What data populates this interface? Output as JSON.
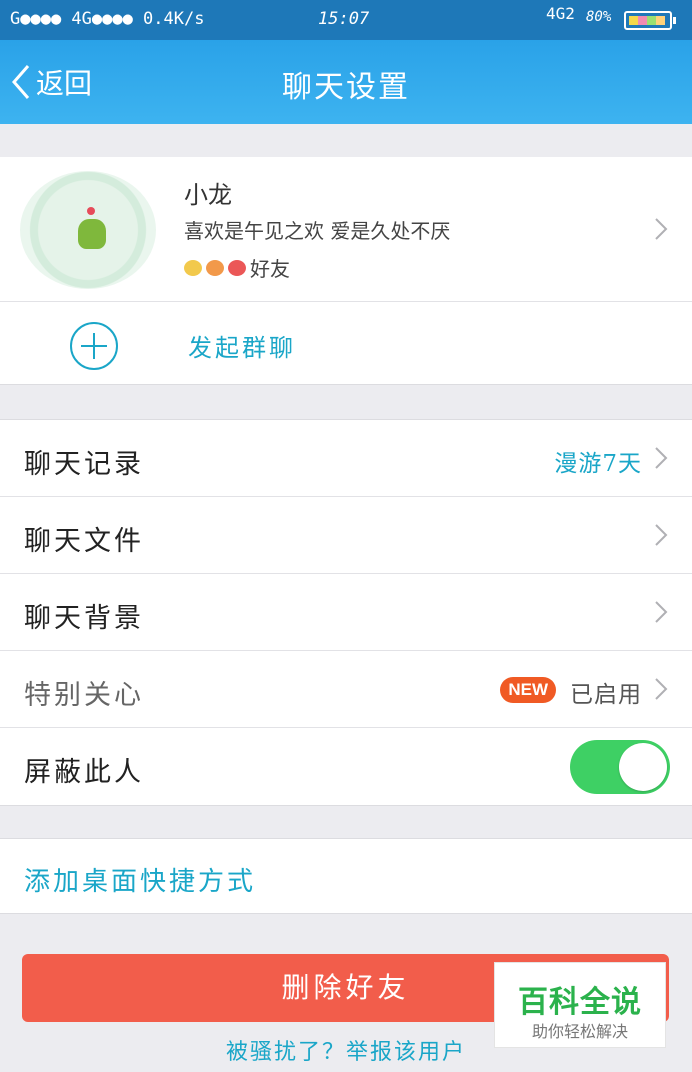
{
  "status_bar": {
    "left": "G●●●● 4G●●●● 0.4K/s",
    "time": "15:07",
    "network": "4G2",
    "battery": "80%"
  },
  "header": {
    "back_label": "返回",
    "title": "聊天设置"
  },
  "profile": {
    "name": "小龙",
    "signature": "喜欢是午见之欢 爱是久处不厌",
    "extra": "好友"
  },
  "group_chat": {
    "label": "发起群聊"
  },
  "settings": {
    "chat_history": {
      "label": "聊天记录",
      "value": "漫游7天"
    },
    "chat_files": {
      "label": "聊天文件"
    },
    "chat_background": {
      "label": "聊天背景"
    },
    "special_care": {
      "label": "特别关心",
      "badge": "NEW",
      "value": "已启用"
    },
    "block": {
      "label": "屏蔽此人",
      "enabled": true
    }
  },
  "shortcut": {
    "label": "添加桌面快捷方式"
  },
  "delete_button": {
    "label": "删除好友"
  },
  "report_link": {
    "label": "被骚扰了？举报该用户"
  },
  "watermark": {
    "title": "百科全说",
    "subtitle": "助你轻松解决"
  },
  "colors": {
    "accent": "#1aa6c8",
    "header": "#2aa2e8",
    "toggle_on": "#3ed064",
    "danger": "#f25d4b",
    "new_badge": "#f05a24"
  }
}
